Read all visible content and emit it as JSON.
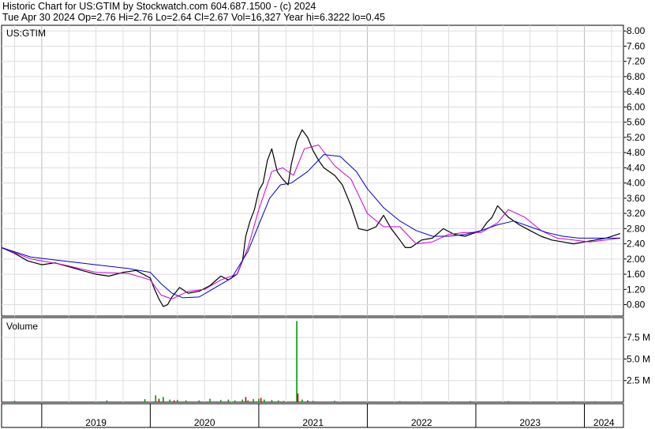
{
  "header": {
    "line1": "Historic Chart for US:GTIM by Stockwatch.com 604.687.1500 - (c) 2024",
    "line2": "Tue Apr 30 2024  Op=2.76  Hi=2.76  Lo=2.64  Cl=2.67  Vol=16,327  Year hi=6.3222  lo=0.45"
  },
  "chart_data": [
    {
      "type": "line",
      "title": "US:GTIM",
      "y_ticks": [
        "8.00",
        "7.60",
        "7.20",
        "6.80",
        "6.40",
        "6.00",
        "5.60",
        "5.20",
        "4.80",
        "4.40",
        "4.00",
        "3.60",
        "3.20",
        "2.80",
        "2.40",
        "2.00",
        "1.60",
        "1.20",
        "0.80"
      ],
      "ylim": [
        0.5,
        8.15
      ],
      "xlim": [
        2018.63,
        2024.36
      ],
      "x_labels": [
        "2019",
        "2020",
        "2021",
        "2022",
        "2023",
        "2024"
      ],
      "year_boundaries": [
        2019.0,
        2020.0,
        2021.0,
        2022.0,
        2023.0,
        2024.0
      ],
      "grid": true,
      "series": [
        {
          "role": "price",
          "color": "#000000",
          "x": [
            2018.63,
            2018.75,
            2018.87,
            2019.0,
            2019.12,
            2019.25,
            2019.37,
            2019.5,
            2019.62,
            2019.75,
            2019.87,
            2020.0,
            2020.04,
            2020.08,
            2020.12,
            2020.16,
            2020.2,
            2020.27,
            2020.35,
            2020.45,
            2020.55,
            2020.65,
            2020.72,
            2020.8,
            2020.85,
            2020.88,
            2020.92,
            2020.96,
            2021.0,
            2021.04,
            2021.08,
            2021.12,
            2021.17,
            2021.22,
            2021.27,
            2021.3,
            2021.35,
            2021.4,
            2021.45,
            2021.5,
            2021.55,
            2021.6,
            2021.65,
            2021.7,
            2021.77,
            2021.85,
            2021.92,
            2022.0,
            2022.08,
            2022.15,
            2022.22,
            2022.3,
            2022.35,
            2022.4,
            2022.5,
            2022.6,
            2022.7,
            2022.8,
            2022.9,
            2023.0,
            2023.05,
            2023.1,
            2023.15,
            2023.2,
            2023.3,
            2023.4,
            2023.5,
            2023.6,
            2023.7,
            2023.8,
            2023.9,
            2024.0,
            2024.1,
            2024.2,
            2024.33
          ],
          "y": [
            2.3,
            2.15,
            1.95,
            1.85,
            1.9,
            1.8,
            1.7,
            1.6,
            1.55,
            1.65,
            1.7,
            1.5,
            1.2,
            0.95,
            0.75,
            0.8,
            1.0,
            1.25,
            1.1,
            1.15,
            1.3,
            1.55,
            1.45,
            1.6,
            1.95,
            2.6,
            3.0,
            3.3,
            3.8,
            4.0,
            4.6,
            4.9,
            4.3,
            4.1,
            3.95,
            4.5,
            5.1,
            5.4,
            5.2,
            4.85,
            4.6,
            4.4,
            4.3,
            4.2,
            3.95,
            3.4,
            2.8,
            2.75,
            2.85,
            3.15,
            2.8,
            2.5,
            2.3,
            2.3,
            2.5,
            2.55,
            2.8,
            2.65,
            2.6,
            2.7,
            2.75,
            2.95,
            3.1,
            3.4,
            3.1,
            2.9,
            2.75,
            2.6,
            2.5,
            2.45,
            2.4,
            2.45,
            2.5,
            2.55,
            2.67
          ]
        },
        {
          "role": "moving-average-short",
          "color": "#cc00cc",
          "x": [
            2018.63,
            2018.9,
            2019.2,
            2019.5,
            2019.8,
            2020.0,
            2020.1,
            2020.2,
            2020.35,
            2020.5,
            2020.65,
            2020.8,
            2020.9,
            2021.0,
            2021.12,
            2021.22,
            2021.32,
            2021.42,
            2021.55,
            2021.7,
            2021.85,
            2022.0,
            2022.15,
            2022.3,
            2022.45,
            2022.6,
            2022.75,
            2022.9,
            2023.05,
            2023.2,
            2023.3,
            2023.45,
            2023.6,
            2023.75,
            2023.9,
            2024.05,
            2024.2,
            2024.33
          ],
          "y": [
            2.3,
            2.0,
            1.85,
            1.65,
            1.62,
            1.45,
            1.05,
            0.95,
            1.15,
            1.2,
            1.45,
            1.6,
            2.3,
            3.3,
            4.3,
            4.4,
            4.2,
            4.9,
            5.0,
            4.45,
            4.1,
            3.2,
            2.85,
            2.85,
            2.4,
            2.45,
            2.65,
            2.7,
            2.7,
            2.95,
            3.3,
            3.1,
            2.75,
            2.55,
            2.5,
            2.45,
            2.5,
            2.55
          ]
        },
        {
          "role": "moving-average-long",
          "color": "#0000cc",
          "x": [
            2018.63,
            2018.9,
            2019.2,
            2019.5,
            2019.8,
            2020.0,
            2020.1,
            2020.2,
            2020.3,
            2020.45,
            2020.6,
            2020.75,
            2020.9,
            2021.0,
            2021.1,
            2021.2,
            2021.3,
            2021.45,
            2021.6,
            2021.75,
            2021.9,
            2022.0,
            2022.15,
            2022.3,
            2022.45,
            2022.6,
            2022.75,
            2022.9,
            2023.05,
            2023.2,
            2023.35,
            2023.5,
            2023.65,
            2023.8,
            2023.95,
            2024.1,
            2024.25,
            2024.33
          ],
          "y": [
            2.3,
            2.05,
            1.95,
            1.85,
            1.75,
            1.65,
            1.35,
            1.1,
            0.98,
            1.0,
            1.25,
            1.5,
            2.2,
            2.9,
            3.6,
            3.95,
            4.0,
            4.3,
            4.75,
            4.7,
            4.3,
            3.85,
            3.35,
            3.0,
            2.75,
            2.6,
            2.6,
            2.65,
            2.75,
            2.9,
            3.0,
            2.85,
            2.7,
            2.6,
            2.55,
            2.55,
            2.55,
            2.55
          ]
        }
      ]
    },
    {
      "type": "bar",
      "title": "Volume",
      "y_ticks": [
        "7.5 M",
        "5.0 M",
        "2.5 M"
      ],
      "ylim": [
        0,
        9.8
      ],
      "xlim": [
        2018.63,
        2024.36
      ],
      "grid": true,
      "series": [
        {
          "name": "",
          "color": "#009900",
          "x": [
            2018.75,
            2019.6,
            2019.95,
            2020.05,
            2020.12,
            2020.18,
            2020.25,
            2020.33,
            2020.45,
            2020.55,
            2020.65,
            2020.72,
            2020.78,
            2020.85,
            2020.9,
            2020.95,
            2021.0,
            2021.05,
            2021.12,
            2021.18,
            2021.23,
            2021.35,
            2021.4,
            2021.5,
            2021.7,
            2022.3,
            2022.95,
            2023.3,
            2023.9,
            2024.1
          ],
          "values": [
            0.15,
            0.2,
            0.35,
            0.8,
            0.6,
            0.3,
            0.25,
            0.2,
            0.2,
            0.4,
            0.25,
            0.3,
            0.2,
            0.3,
            0.2,
            0.35,
            0.4,
            0.3,
            0.25,
            0.2,
            0.15,
            9.4,
            0.3,
            0.15,
            0.15,
            0.12,
            0.12,
            0.12,
            0.1,
            0.1
          ]
        },
        {
          "name": "",
          "color": "#cc0000",
          "x": [
            2020.08,
            2020.22,
            2020.88,
            2021.02,
            2021.36,
            2021.45
          ],
          "values": [
            0.4,
            0.2,
            0.6,
            0.5,
            1.0,
            0.2
          ]
        }
      ]
    }
  ]
}
